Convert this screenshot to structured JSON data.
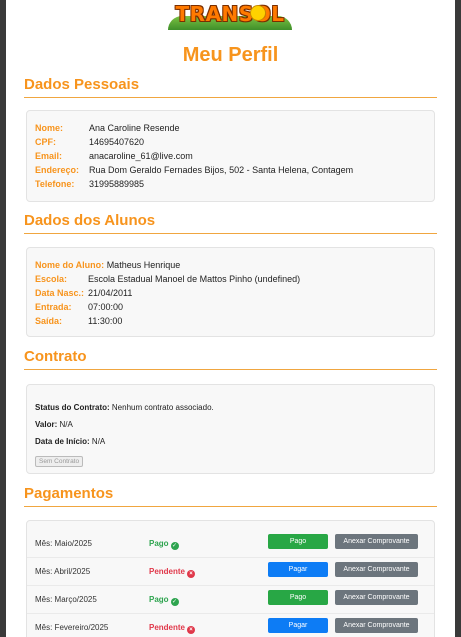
{
  "logo": {
    "text": "TRANSOL"
  },
  "page_title": "Meu Perfil",
  "personal": {
    "title": "Dados Pessoais",
    "rows": [
      {
        "label": "Nome:",
        "value": "Ana Caroline Resende"
      },
      {
        "label": "CPF:",
        "value": "14695407620"
      },
      {
        "label": "Email:",
        "value": "anacaroline_61@live.com"
      },
      {
        "label": "Endereço:",
        "value": "Rua Dom Geraldo Fernades Bijos, 502 - Santa Helena, Contagem"
      },
      {
        "label": "Telefone:",
        "value": "31995889985"
      }
    ]
  },
  "students": {
    "title": "Dados dos Alunos",
    "rows": [
      {
        "label": "Nome do Aluno:",
        "value": "Matheus Henrique"
      },
      {
        "label": "Escola:",
        "value": "Escola Estadual Manoel de Mattos Pinho (undefined)"
      },
      {
        "label": "Data Nasc.:",
        "value": "21/04/2011"
      },
      {
        "label": "Entrada:",
        "value": "07:00:00"
      },
      {
        "label": "Saída:",
        "value": "11:30:00"
      }
    ]
  },
  "contract": {
    "title": "Contrato",
    "status_label": "Status do Contrato:",
    "status_value": "Nenhum contrato associado.",
    "value_label": "Valor:",
    "value_value": "N/A",
    "start_label": "Data de Início:",
    "start_value": "N/A",
    "button": "Sem Contrato"
  },
  "payments": {
    "title": "Pagamentos",
    "items": [
      {
        "month": "Mês: Maio/2025",
        "status": "Pago",
        "status_kind": "ok",
        "pay_button": "Pago",
        "attach_button": "Anexar Comprovante"
      },
      {
        "month": "Mês: Abril/2025",
        "status": "Pendente",
        "status_kind": "pend",
        "pay_button": "Pagar",
        "attach_button": "Anexar Comprovante"
      },
      {
        "month": "Mês: Março/2025",
        "status": "Pago",
        "status_kind": "ok",
        "pay_button": "Pago",
        "attach_button": "Anexar Comprovante"
      },
      {
        "month": "Mês: Fevereiro/2025",
        "status": "Pendente",
        "status_kind": "pend",
        "pay_button": "Pagar",
        "attach_button": "Anexar Comprovante"
      }
    ]
  },
  "colors": {
    "accent": "#f7941d",
    "success": "#28a745",
    "primary": "#0d7cf5",
    "secondary": "#6c757d",
    "danger": "#e0384a"
  }
}
